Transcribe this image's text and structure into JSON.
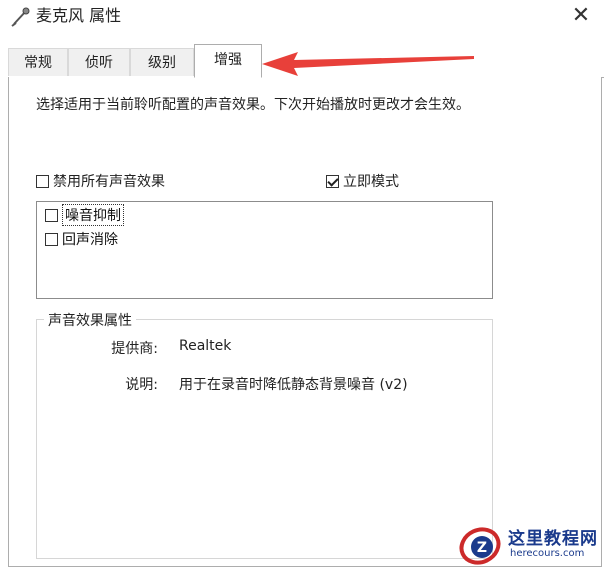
{
  "window": {
    "title": "麦克风 属性",
    "close_glyph": "✕"
  },
  "tabs": [
    {
      "label": "常规",
      "active": false
    },
    {
      "label": "侦听",
      "active": false
    },
    {
      "label": "级别",
      "active": false
    },
    {
      "label": "增强",
      "active": true
    }
  ],
  "enhancements": {
    "description": "选择适用于当前聆听配置的声音效果。下次开始播放时更改才会生效。",
    "disable_all": {
      "label": "禁用所有声音效果",
      "checked": false
    },
    "immediate_mode": {
      "label": "立即模式",
      "checked": true
    },
    "effects": [
      {
        "label": "噪音抑制",
        "checked": false,
        "selected": true
      },
      {
        "label": "回声消除",
        "checked": false,
        "selected": false
      }
    ]
  },
  "properties": {
    "group_title": "声音效果属性",
    "provider_label": "提供商:",
    "provider_value": "Realtek",
    "description_label": "说明:",
    "description_value": "用于在录音时降低静态背景噪音 (v2)"
  },
  "annotation": {
    "arrow_color": "#e8403a"
  },
  "watermark": {
    "title": "这里教程网",
    "url": "herecours.com",
    "color": "#1a3a8c"
  }
}
